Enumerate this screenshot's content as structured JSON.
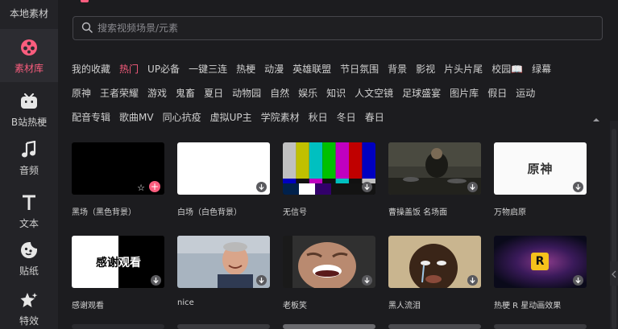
{
  "sidebar": {
    "top_label": "本地素材",
    "items": [
      {
        "label": "素材库",
        "icon": "film-reel-icon",
        "active": true
      },
      {
        "label": "B站热梗",
        "icon": "bilibili-tv-icon",
        "active": false
      },
      {
        "label": "音频",
        "icon": "music-note-icon",
        "active": false
      },
      {
        "label": "文本",
        "icon": "text-t-icon",
        "active": false
      },
      {
        "label": "贴纸",
        "icon": "sticker-icon",
        "active": false
      },
      {
        "label": "特效",
        "icon": "sparkle-star-icon",
        "active": false
      }
    ]
  },
  "search": {
    "placeholder": "搜索视频场景/元素"
  },
  "tags": {
    "row1": [
      "我的收藏",
      "热门",
      "UP必备",
      "一键三连",
      "热梗",
      "动漫",
      "英雄联盟",
      "节日氛围",
      "背景",
      "影视",
      "片头片尾",
      "校园📖",
      "绿幕"
    ],
    "row2": [
      "原神",
      "王者荣耀",
      "游戏",
      "鬼畜",
      "夏日",
      "动物园",
      "自然",
      "娱乐",
      "知识",
      "人文空镜",
      "足球盛宴",
      "图片库",
      "假日",
      "运动"
    ],
    "row3": [
      "配音专辑",
      "歌曲MV",
      "同心抗疫",
      "虚拟UP主",
      "学院素材",
      "秋日",
      "冬日",
      "春日"
    ],
    "active": "热门"
  },
  "cards": [
    {
      "label": "黑场（黑色背景）"
    },
    {
      "label": "白场（白色背景）"
    },
    {
      "label": "无信号"
    },
    {
      "label": "曹操盖饭 名场面"
    },
    {
      "label": "万物启原"
    },
    {
      "label": "感谢观看"
    },
    {
      "label": "nice"
    },
    {
      "label": "老板笑"
    },
    {
      "label": "黑人流泪"
    },
    {
      "label": "热梗 R 星动画效果"
    }
  ],
  "thumb_text": {
    "genshin": "原神",
    "thanks_left": "感谢",
    "thanks_right": "观看",
    "rockstar": "R"
  },
  "colors": {
    "accent": "#fb5d7e",
    "sidebar_bg": "#232327",
    "main_bg": "#1c1c1f"
  }
}
